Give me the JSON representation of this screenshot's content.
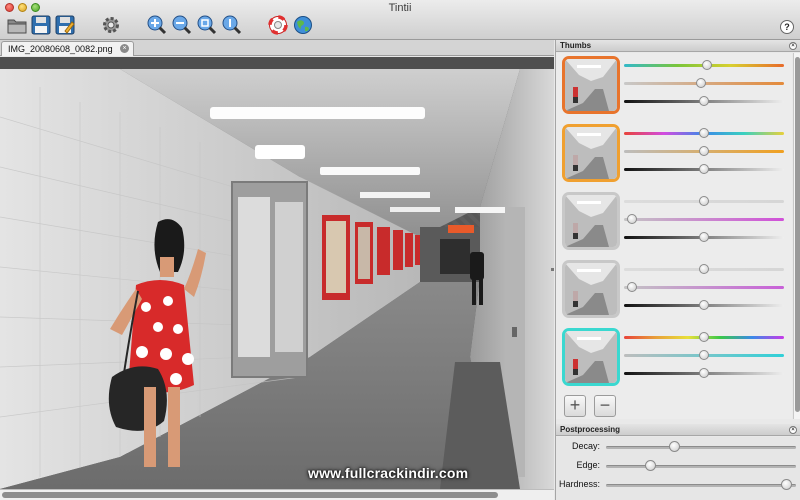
{
  "window": {
    "title": "Tintii"
  },
  "toolbar": {
    "items": [
      {
        "name": "open-icon",
        "interactable": true
      },
      {
        "name": "save-icon",
        "interactable": true
      },
      {
        "name": "save-as-icon",
        "interactable": true
      },
      {
        "name": "settings-gear-icon",
        "interactable": true
      },
      {
        "name": "zoom-in-icon",
        "interactable": true
      },
      {
        "name": "zoom-out-icon",
        "interactable": true
      },
      {
        "name": "zoom-fit-icon",
        "interactable": true
      },
      {
        "name": "zoom-actual-icon",
        "interactable": true
      },
      {
        "name": "help-lifebuoy-icon",
        "interactable": true
      },
      {
        "name": "website-globe-icon",
        "interactable": true
      }
    ],
    "help_label": "?"
  },
  "document": {
    "tab_label": "IMG_20080608_0082.png",
    "tab_close": "×"
  },
  "thumbs_panel": {
    "title": "Thumbs",
    "close": "×",
    "add_label": "+",
    "remove_label": "−",
    "thumbs": [
      {
        "border_color": "#e8742c",
        "sliders": [
          {
            "gradient": "linear-gradient(90deg,#32b9c9,#7ac53a,#d8d030,#e86a2a)",
            "value": 0.52
          },
          {
            "gradient": "linear-gradient(90deg,#c8c8c8,#e48a3a)",
            "value": 0.48
          },
          {
            "gradient": "linear-gradient(90deg,#111,#eee)",
            "value": 0.5
          }
        ]
      },
      {
        "border_color": "#f0a030",
        "sliders": [
          {
            "gradient": "linear-gradient(90deg,#e8433a,#d14ce0,#3a8ae8,#3ad0c0,#e8d03a)",
            "value": 0.5
          },
          {
            "gradient": "linear-gradient(90deg,#bdbdbd,#f0a020)",
            "value": 0.5
          },
          {
            "gradient": "linear-gradient(90deg,#111,#eee)",
            "value": 0.5
          }
        ]
      },
      {
        "border_color": "#c8c8c8",
        "sliders": [
          {
            "gradient": "linear-gradient(90deg,#dcdcdc,#d6d6d6)",
            "value": 0.5
          },
          {
            "gradient": "linear-gradient(90deg,#c4c4c4,#d050d8)",
            "value": 0.02
          },
          {
            "gradient": "linear-gradient(90deg,#111,#eee)",
            "value": 0.5
          }
        ]
      },
      {
        "border_color": "#c8c8c8",
        "sliders": [
          {
            "gradient": "linear-gradient(90deg,#dcdcdc,#d6d6d6)",
            "value": 0.5
          },
          {
            "gradient": "linear-gradient(90deg,#c4c4c4,#c860d8)",
            "value": 0.02
          },
          {
            "gradient": "linear-gradient(90deg,#111,#eee)",
            "value": 0.5
          }
        ]
      },
      {
        "border_color": "#3ad8d0",
        "sliders": [
          {
            "gradient": "linear-gradient(90deg,#e8433a,#e8a03a,#e8e03a,#3ac848,#3a8ae8,#c83ae8)",
            "value": 0.5
          },
          {
            "gradient": "linear-gradient(90deg,#bdbdbd,#30d0d8)",
            "value": 0.5
          },
          {
            "gradient": "linear-gradient(90deg,#111,#eee)",
            "value": 0.5
          }
        ]
      }
    ]
  },
  "postprocessing": {
    "title": "Postprocessing",
    "close": "×",
    "rows": [
      {
        "label": "Decay:",
        "value": 0.35
      },
      {
        "label": "Edge:",
        "value": 0.22
      },
      {
        "label": "Hardness:",
        "value": 0.98
      }
    ]
  },
  "watermark": "www.fullcrackindir.com"
}
